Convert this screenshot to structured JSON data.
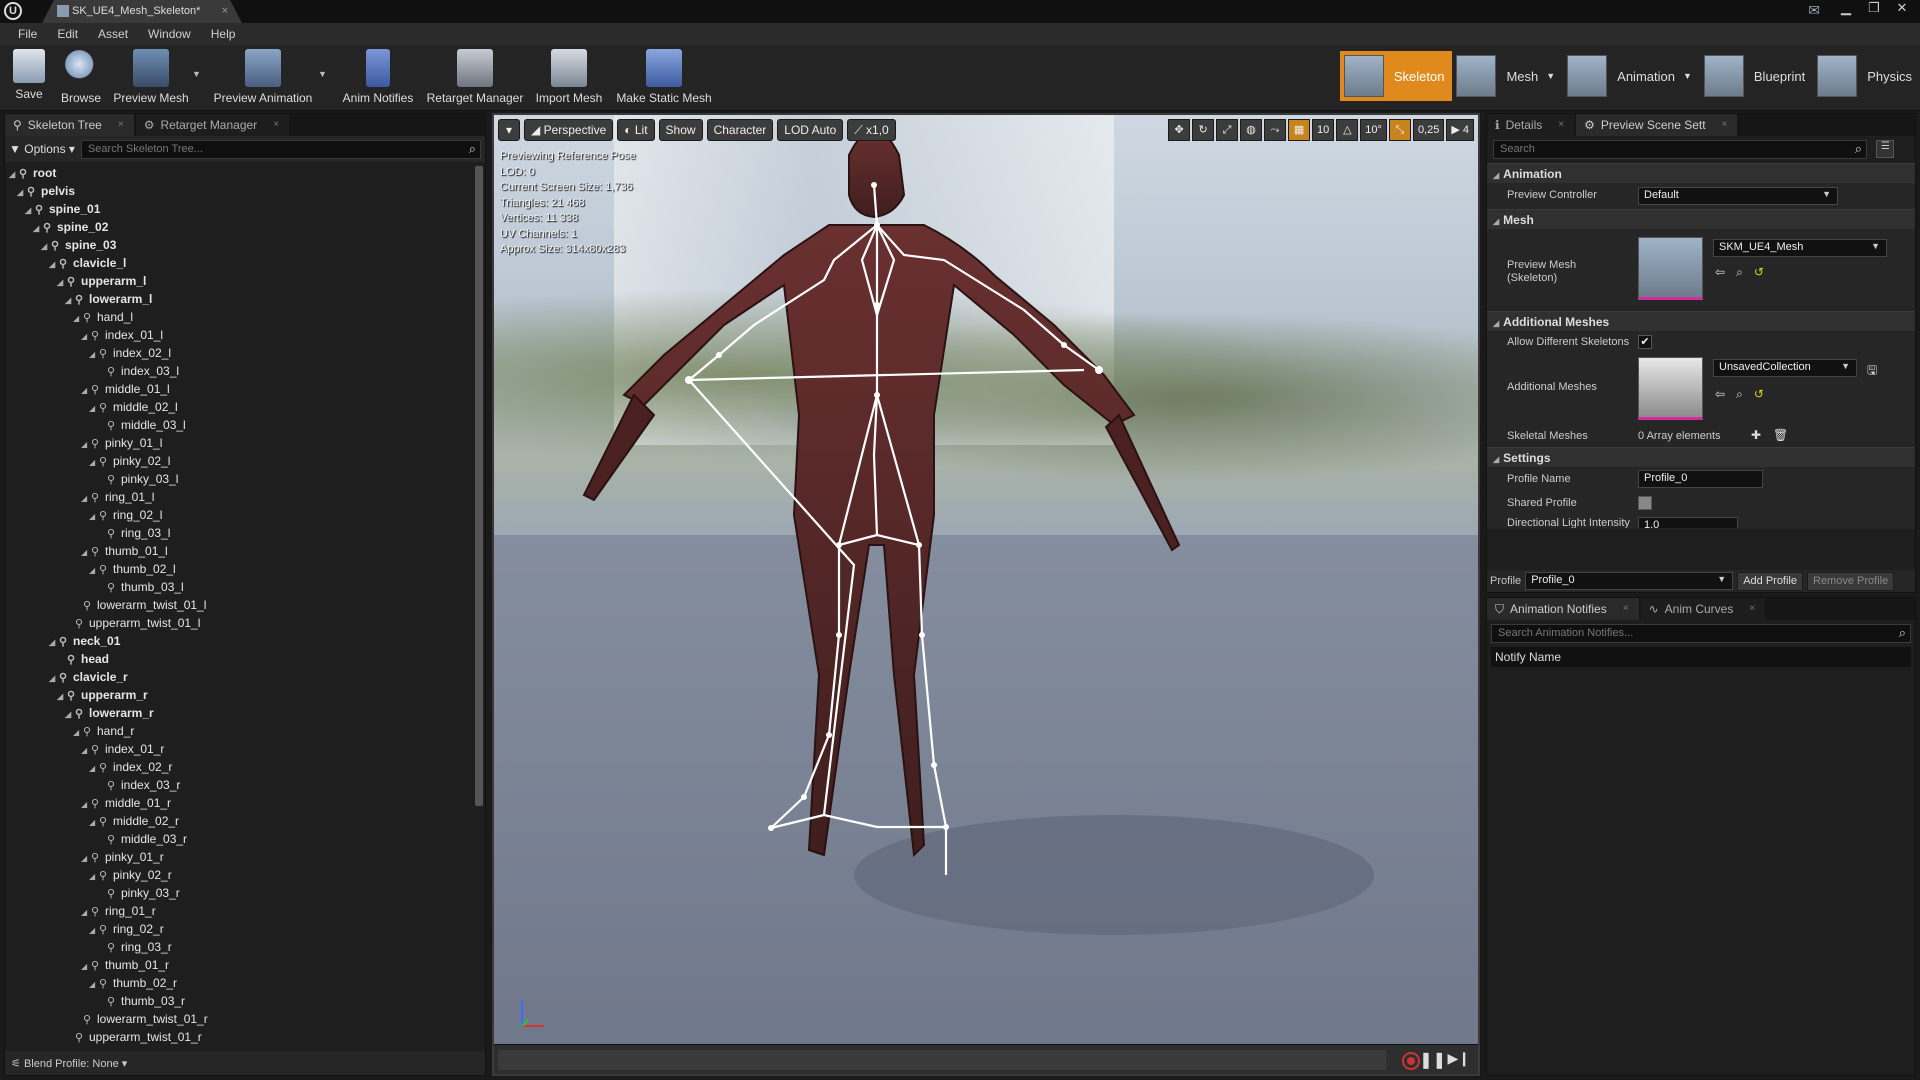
{
  "window": {
    "tab_title": "SK_UE4_Mesh_Skeleton*",
    "logo": "U"
  },
  "menu": [
    "File",
    "Edit",
    "Asset",
    "Window",
    "Help"
  ],
  "toolbar": {
    "save": "Save",
    "browse": "Browse",
    "preview_mesh": "Preview Mesh",
    "preview_animation": "Preview Animation",
    "anim_notifies": "Anim Notifies",
    "retarget_manager": "Retarget Manager",
    "import_mesh": "Import Mesh",
    "make_static_mesh": "Make Static Mesh"
  },
  "modes": {
    "skeleton": "Skeleton",
    "mesh": "Mesh",
    "animation": "Animation",
    "blueprint": "Blueprint",
    "physics": "Physics"
  },
  "left": {
    "tab_skeleton_tree": "Skeleton Tree",
    "tab_retarget": "Retarget Manager",
    "options": "Options",
    "search_placeholder": "Search Skeleton Tree...",
    "blend_profile": "Blend Profile: None",
    "bones": [
      {
        "name": "root",
        "depth": 0,
        "bold": true,
        "expander": true
      },
      {
        "name": "pelvis",
        "depth": 1,
        "bold": true,
        "expander": true
      },
      {
        "name": "spine_01",
        "depth": 2,
        "bold": true,
        "expander": true
      },
      {
        "name": "spine_02",
        "depth": 3,
        "bold": true,
        "expander": true
      },
      {
        "name": "spine_03",
        "depth": 4,
        "bold": true,
        "expander": true
      },
      {
        "name": "clavicle_l",
        "depth": 5,
        "bold": true,
        "expander": true
      },
      {
        "name": "upperarm_l",
        "depth": 6,
        "bold": true,
        "expander": true
      },
      {
        "name": "lowerarm_l",
        "depth": 7,
        "bold": true,
        "expander": true
      },
      {
        "name": "hand_l",
        "depth": 8,
        "bold": false,
        "expander": true
      },
      {
        "name": "index_01_l",
        "depth": 9,
        "bold": false,
        "expander": true
      },
      {
        "name": "index_02_l",
        "depth": 10,
        "bold": false,
        "expander": true
      },
      {
        "name": "index_03_l",
        "depth": 11,
        "bold": false,
        "expander": false
      },
      {
        "name": "middle_01_l",
        "depth": 9,
        "bold": false,
        "expander": true
      },
      {
        "name": "middle_02_l",
        "depth": 10,
        "bold": false,
        "expander": true
      },
      {
        "name": "middle_03_l",
        "depth": 11,
        "bold": false,
        "expander": false
      },
      {
        "name": "pinky_01_l",
        "depth": 9,
        "bold": false,
        "expander": true
      },
      {
        "name": "pinky_02_l",
        "depth": 10,
        "bold": false,
        "expander": true
      },
      {
        "name": "pinky_03_l",
        "depth": 11,
        "bold": false,
        "expander": false
      },
      {
        "name": "ring_01_l",
        "depth": 9,
        "bold": false,
        "expander": true
      },
      {
        "name": "ring_02_l",
        "depth": 10,
        "bold": false,
        "expander": true
      },
      {
        "name": "ring_03_l",
        "depth": 11,
        "bold": false,
        "expander": false
      },
      {
        "name": "thumb_01_l",
        "depth": 9,
        "bold": false,
        "expander": true
      },
      {
        "name": "thumb_02_l",
        "depth": 10,
        "bold": false,
        "expander": true
      },
      {
        "name": "thumb_03_l",
        "depth": 11,
        "bold": false,
        "expander": false
      },
      {
        "name": "lowerarm_twist_01_l",
        "depth": 8,
        "bold": false,
        "expander": false
      },
      {
        "name": "upperarm_twist_01_l",
        "depth": 7,
        "bold": false,
        "expander": false
      },
      {
        "name": "neck_01",
        "depth": 5,
        "bold": true,
        "expander": true
      },
      {
        "name": "head",
        "depth": 6,
        "bold": true,
        "expander": false
      },
      {
        "name": "clavicle_r",
        "depth": 5,
        "bold": true,
        "expander": true
      },
      {
        "name": "upperarm_r",
        "depth": 6,
        "bold": true,
        "expander": true
      },
      {
        "name": "lowerarm_r",
        "depth": 7,
        "bold": true,
        "expander": true
      },
      {
        "name": "hand_r",
        "depth": 8,
        "bold": false,
        "expander": true
      },
      {
        "name": "index_01_r",
        "depth": 9,
        "bold": false,
        "expander": true
      },
      {
        "name": "index_02_r",
        "depth": 10,
        "bold": false,
        "expander": true
      },
      {
        "name": "index_03_r",
        "depth": 11,
        "bold": false,
        "expander": false
      },
      {
        "name": "middle_01_r",
        "depth": 9,
        "bold": false,
        "expander": true
      },
      {
        "name": "middle_02_r",
        "depth": 10,
        "bold": false,
        "expander": true
      },
      {
        "name": "middle_03_r",
        "depth": 11,
        "bold": false,
        "expander": false
      },
      {
        "name": "pinky_01_r",
        "depth": 9,
        "bold": false,
        "expander": true
      },
      {
        "name": "pinky_02_r",
        "depth": 10,
        "bold": false,
        "expander": true
      },
      {
        "name": "pinky_03_r",
        "depth": 11,
        "bold": false,
        "expander": false
      },
      {
        "name": "ring_01_r",
        "depth": 9,
        "bold": false,
        "expander": true
      },
      {
        "name": "ring_02_r",
        "depth": 10,
        "bold": false,
        "expander": true
      },
      {
        "name": "ring_03_r",
        "depth": 11,
        "bold": false,
        "expander": false
      },
      {
        "name": "thumb_01_r",
        "depth": 9,
        "bold": false,
        "expander": true
      },
      {
        "name": "thumb_02_r",
        "depth": 10,
        "bold": false,
        "expander": true
      },
      {
        "name": "thumb_03_r",
        "depth": 11,
        "bold": false,
        "expander": false
      },
      {
        "name": "lowerarm_twist_01_r",
        "depth": 8,
        "bold": false,
        "expander": false
      },
      {
        "name": "upperarm_twist_01_r",
        "depth": 7,
        "bold": false,
        "expander": false
      }
    ]
  },
  "viewport": {
    "perspective": "Perspective",
    "lit": "Lit",
    "show": "Show",
    "character": "Character",
    "lod": "LOD Auto",
    "speed": "x1,0",
    "grid_snap": "10",
    "rot_snap": "10°",
    "scale_snap": "0,25",
    "cam_speed": "4",
    "info": [
      "Previewing Reference Pose",
      "LOD: 0",
      "Current Screen Size: 1,736",
      "Triangles: 21 468",
      "Vertices: 11 338",
      "UV Channels: 1",
      "Approx Size: 314x80x283"
    ]
  },
  "details": {
    "tab_details": "Details",
    "tab_preview": "Preview Scene Sett",
    "search_placeholder": "Search",
    "cat_animation": "Animation",
    "preview_controller_label": "Preview Controller",
    "preview_controller_value": "Default",
    "cat_mesh": "Mesh",
    "preview_mesh_label": "Preview Mesh (Skeleton)",
    "preview_mesh_value": "SKM_UE4_Mesh",
    "cat_additional": "Additional Meshes",
    "allow_diff_label": "Allow Different Skeletons",
    "allow_diff_checked": "✔",
    "additional_label": "Additional Meshes",
    "additional_value": "UnsavedCollection",
    "skeletal_label": "Skeletal Meshes",
    "skeletal_value": "0 Array elements",
    "cat_settings": "Settings",
    "profile_name_label": "Profile Name",
    "profile_name_value": "Profile_0",
    "shared_label": "Shared Profile",
    "dir_light_label": "Directional Light Intensity",
    "dir_light_value": "1,0",
    "profile_label": "Profile",
    "profile_value": "Profile_0",
    "add_profile": "Add Profile",
    "remove_profile": "Remove Profile"
  },
  "notifies": {
    "tab_notifies": "Animation Notifies",
    "tab_curves": "Anim Curves",
    "search_placeholder": "Search Animation Notifies...",
    "header": "Notify Name"
  },
  "colors": {
    "accent": "#e08a1e",
    "mesh_accent": "#d62aa0",
    "bone_line": "#ffffff"
  }
}
